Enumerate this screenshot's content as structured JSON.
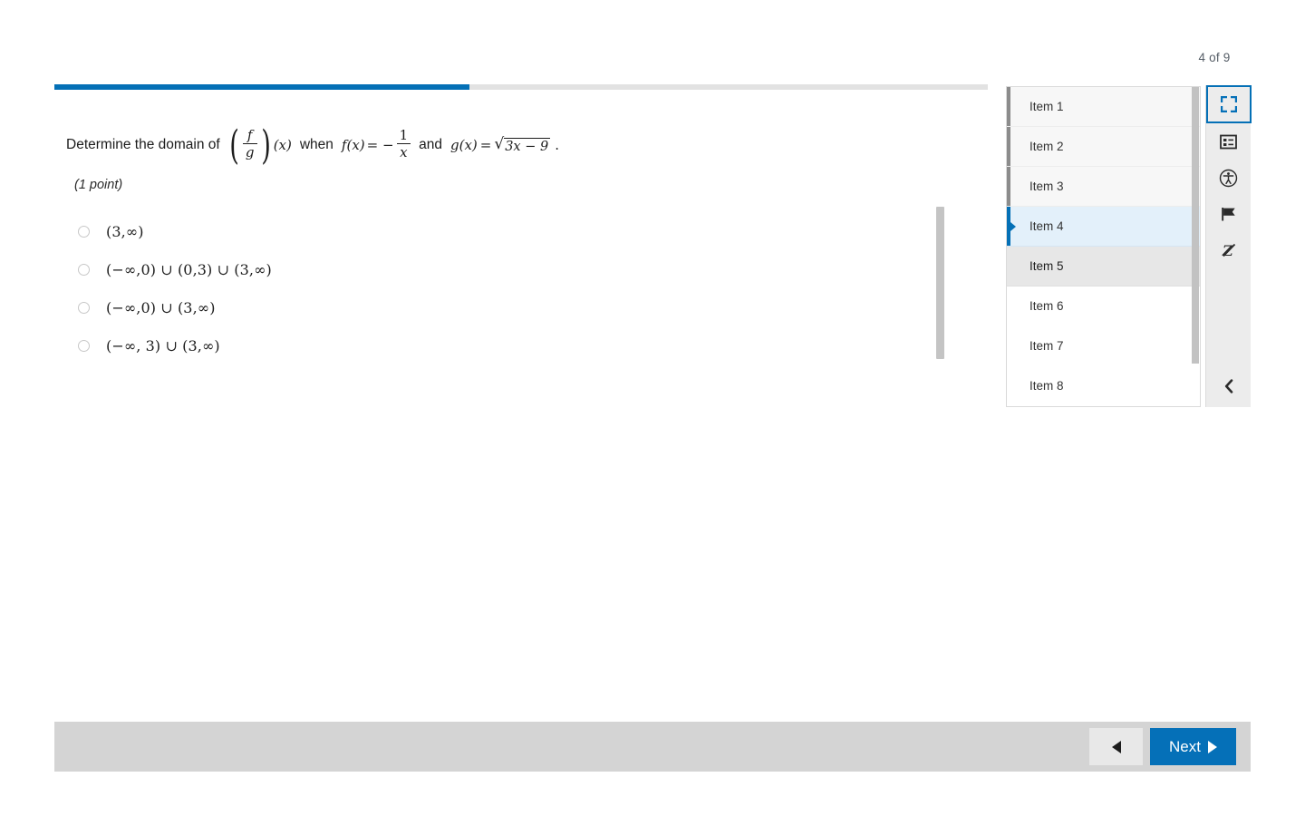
{
  "header": {
    "page_counter": "4 of 9"
  },
  "progress": {
    "percent": 44.5
  },
  "question": {
    "lead_text": "Determine the domain of",
    "fraction_numerator": "f",
    "fraction_denominator": "g",
    "of_variable": "(x)",
    "when_word": "when",
    "f_label": "f",
    "f_arg": "(x)",
    "f_equals": "= −",
    "f_num": "1",
    "f_den": "x",
    "and_word": "and",
    "g_label": "g",
    "g_arg": "(x)",
    "g_equals": "=",
    "g_radicand": "3x − 9",
    "period": ".",
    "points_label": "(1 point)"
  },
  "options": [
    {
      "id": "opt-a",
      "text": "(3,∞)",
      "selected": false
    },
    {
      "id": "opt-b",
      "text": "(−∞,0) ∪ (0,3) ∪ (3,∞)",
      "selected": false
    },
    {
      "id": "opt-c",
      "text": "(−∞,0) ∪ (3,∞)",
      "selected": false
    },
    {
      "id": "opt-d",
      "text": "(−∞, 3) ∪ (3,∞)",
      "selected": false
    }
  ],
  "item_panel": [
    {
      "label": "Item 1",
      "state": "visited"
    },
    {
      "label": "Item 2",
      "state": "visited"
    },
    {
      "label": "Item 3",
      "state": "visited"
    },
    {
      "label": "Item 4",
      "state": "current"
    },
    {
      "label": "Item 5",
      "state": "hovered"
    },
    {
      "label": "Item 6",
      "state": "plain"
    },
    {
      "label": "Item 7",
      "state": "plain"
    },
    {
      "label": "Item 8",
      "state": "plain"
    }
  ],
  "toolbar": [
    {
      "icon": "fullscreen-icon",
      "focused": true
    },
    {
      "icon": "reference-list-icon",
      "focused": false
    },
    {
      "icon": "accessibility-icon",
      "focused": false
    },
    {
      "icon": "flag-icon",
      "focused": false
    },
    {
      "icon": "no-zoom-icon",
      "focused": false
    }
  ],
  "toolbar_collapse": {
    "icon": "chevron-left-icon"
  },
  "footer": {
    "prev_label": "",
    "next_label": "Next"
  },
  "colors": {
    "accent_blue": "#0470b6",
    "next_button": "#0570b8",
    "current_item_bg": "#e3f0fa",
    "hovered_item_bg": "#e7e7e7",
    "footer_bg": "#d4d4d4",
    "progress_track": "#e2e2e2"
  }
}
